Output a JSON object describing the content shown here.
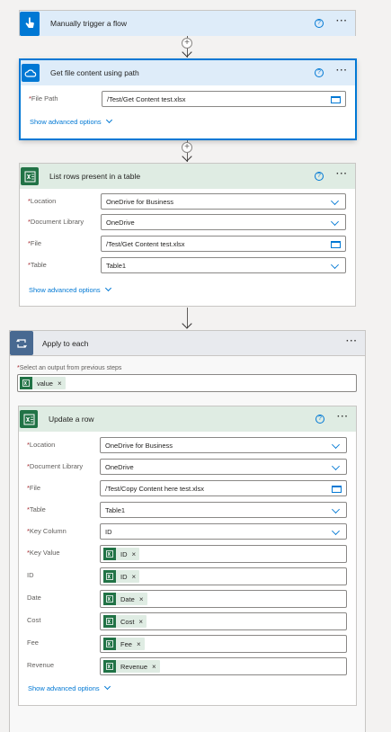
{
  "trigger": {
    "title": "Manually trigger a flow"
  },
  "get_file": {
    "title": "Get file content using path",
    "file_path_label": "File Path",
    "file_path_value": "/Test/Get Content test.xlsx",
    "advanced": "Show advanced options"
  },
  "list_rows": {
    "title": "List rows present in a table",
    "fields": [
      {
        "label": "Location",
        "value": "OneDrive for Business"
      },
      {
        "label": "Document Library",
        "value": "OneDrive"
      },
      {
        "label": "File",
        "value": "/Test/Get Content test.xlsx"
      },
      {
        "label": "Table",
        "value": "Table1"
      }
    ],
    "advanced": "Show advanced options"
  },
  "apply_each": {
    "title": "Apply to each",
    "select_label": "Select an output from previous steps",
    "token": "value"
  },
  "update_row": {
    "title": "Update a row",
    "fields": [
      {
        "label": "Location",
        "value": "OneDrive for Business"
      },
      {
        "label": "Document Library",
        "value": "OneDrive"
      },
      {
        "label": "File",
        "value": "/Test/Copy Content here test.xlsx"
      },
      {
        "label": "Table",
        "value": "Table1"
      },
      {
        "label": "Key Column",
        "value": "ID"
      },
      {
        "label": "Key Value",
        "token": "ID"
      },
      {
        "label": "ID",
        "token": "ID"
      },
      {
        "label": "Date",
        "token": "Date"
      },
      {
        "label": "Cost",
        "token": "Cost"
      },
      {
        "label": "Fee",
        "token": "Fee"
      },
      {
        "label": "Revenue",
        "token": "Revenue"
      }
    ],
    "advanced": "Show advanced options"
  },
  "symbols": {
    "required": "*",
    "help": "?",
    "more": "···",
    "remove": "×",
    "plus": "+"
  },
  "colors": {
    "accent": "#0078d4",
    "excel": "#217346",
    "onedrive": "#0078d4",
    "loop": "#486991"
  }
}
